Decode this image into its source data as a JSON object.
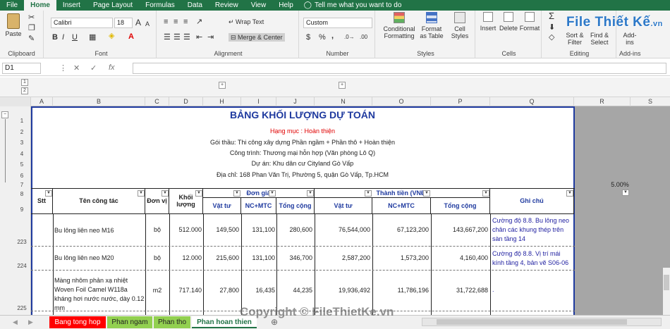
{
  "tabs": [
    "File",
    "Home",
    "Insert",
    "Page Layout",
    "Formulas",
    "Data",
    "Review",
    "View",
    "Help"
  ],
  "tell_me": "Tell me what you want to do",
  "ribbon": {
    "clipboard": {
      "label": "Clipboard",
      "paste": "Paste"
    },
    "font": {
      "label": "Font",
      "name": "Calibri",
      "size": "18",
      "bold": "B",
      "italic": "I",
      "underline": "U",
      "grow": "A",
      "shrink": "A"
    },
    "alignment": {
      "label": "Alignment",
      "wrap": "Wrap Text",
      "merge": "Merge & Center"
    },
    "number": {
      "label": "Number",
      "format": "Custom",
      "currency": "$",
      "percent": "%",
      "comma": ","
    },
    "styles": {
      "label": "Styles",
      "conditional": "Conditional Formatting",
      "format_table": "Format as Table",
      "cell_styles": "Cell Styles"
    },
    "cells": {
      "label": "Cells",
      "insert": "Insert",
      "delete": "Delete",
      "format": "Format"
    },
    "editing": {
      "label": "Editing",
      "sort": "Sort & Filter",
      "find": "Find & Select"
    },
    "addins": {
      "label": "Add-ins",
      "addins": "Add-ins"
    }
  },
  "logo": {
    "main": "File Thiết Kế",
    "suffix": ".vn"
  },
  "formula_bar": {
    "name_box": "D1",
    "fx": "fx",
    "formula": ""
  },
  "outline": {
    "levels": [
      "1",
      "2"
    ],
    "col_levels": [
      "1",
      "2"
    ],
    "plus": "+",
    "minus": "−"
  },
  "columns": [
    "A",
    "B",
    "C",
    "D",
    "H",
    "I",
    "J",
    "N",
    "O",
    "P",
    "Q",
    "R",
    "S"
  ],
  "rows": [
    "1",
    "2",
    "3",
    "4",
    "5",
    "6",
    "7",
    "8",
    "9",
    "223",
    "224",
    "225"
  ],
  "report": {
    "title": "BẢNG KHỐI LƯỢNG DỰ TOÁN",
    "category": "Hạng mục : Hoàn thiện",
    "package": "Gói thầu: Thi công xây dựng Phần ngầm + Phần thô + Hoàn thiện",
    "project": "Công trình: Thương mại hỗn hợp (Văn phòng Lô Q)",
    "scheme": "Dự án: Khu dân cư Cityland Gò Vấp",
    "address": "Địa chỉ: 168 Phan Văn Trị, Phường 5, quận Gò Vấp, Tp.HCM",
    "percent": "5.00%"
  },
  "headers": {
    "stt": "Stt",
    "work": "Tên công tác",
    "unit": "Đơn vị",
    "qty": "Khối lượng",
    "unit_price": "Đơn giá",
    "total": "Thành tiền (VNĐ)",
    "note": "Ghi chú",
    "material": "Vật tư",
    "labor": "NC+MTC",
    "sum": "Tổng cộng"
  },
  "table_rows": [
    {
      "name": "Bu lông liên neo  M16",
      "unit": "bộ",
      "qty": "512.000",
      "p_mat": "149,500",
      "p_lab": "131,100",
      "p_sum": "280,600",
      "t_mat": "76,544,000",
      "t_lab": "67,123,200",
      "t_sum": "143,667,200",
      "note": "Cường độ 8.8. Bu lông neo chân các khung thép trên sàn tầng 14"
    },
    {
      "name": "Bu lông liên neo  M20",
      "unit": "bộ",
      "qty": "12.000",
      "p_mat": "215,600",
      "p_lab": "131,100",
      "p_sum": "346,700",
      "t_mat": "2,587,200",
      "t_lab": "1,573,200",
      "t_sum": "4,160,400",
      "note": "Cường độ 8.8. Vị trí mái kính tầng 4, bản vẽ S06-06"
    },
    {
      "name": "Màng nhôm phản xạ nhiệt Woven Foil Camel W118a kháng hơi nước nước, dày 0.12 mm",
      "unit": "m2",
      "qty": "717.140",
      "p_mat": "27,800",
      "p_lab": "16,435",
      "p_sum": "44,235",
      "t_mat": "19,936,492",
      "t_lab": "11,786,196",
      "t_sum": "31,722,688",
      "note": "."
    }
  ],
  "sheets": [
    {
      "name": "Bang tong hop",
      "color": "#ff0000",
      "text": "#ffffff"
    },
    {
      "name": "Phan ngam",
      "color": "#92d050",
      "text": "#222222"
    },
    {
      "name": "Phan tho",
      "color": "#92d050",
      "text": "#222222"
    },
    {
      "name": "Phan hoan thien",
      "color": "#ffffff",
      "text": "#217346"
    }
  ],
  "watermark": "Copyright © FileThietKe.vn",
  "colors": {
    "excel_green": "#217346",
    "title_blue": "#1f3a9f",
    "red": "#e00000",
    "note_blue": "#1f1fa0"
  }
}
